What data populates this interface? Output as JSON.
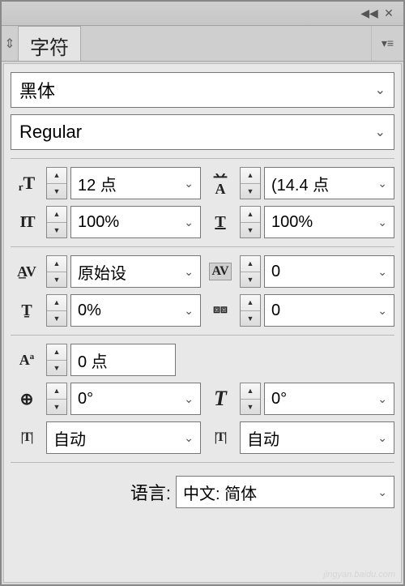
{
  "panel": {
    "tab_title": "字符"
  },
  "font": {
    "family": "黑体",
    "style": "Regular"
  },
  "size": {
    "font_size": "12 点",
    "leading": "(14.4 点",
    "v_scale": "100%",
    "h_scale": "100%"
  },
  "spacing": {
    "kerning": "原始设",
    "tracking": "0",
    "baseline_pct": "0%",
    "baseline2": "0"
  },
  "advanced": {
    "shift": "0 点",
    "rotation": "0°",
    "skew": "0°",
    "box1": "自动",
    "box2": "自动"
  },
  "language": {
    "label": "语言:",
    "value": "中文: 简体"
  },
  "watermark": "jingyan.baidu.com"
}
